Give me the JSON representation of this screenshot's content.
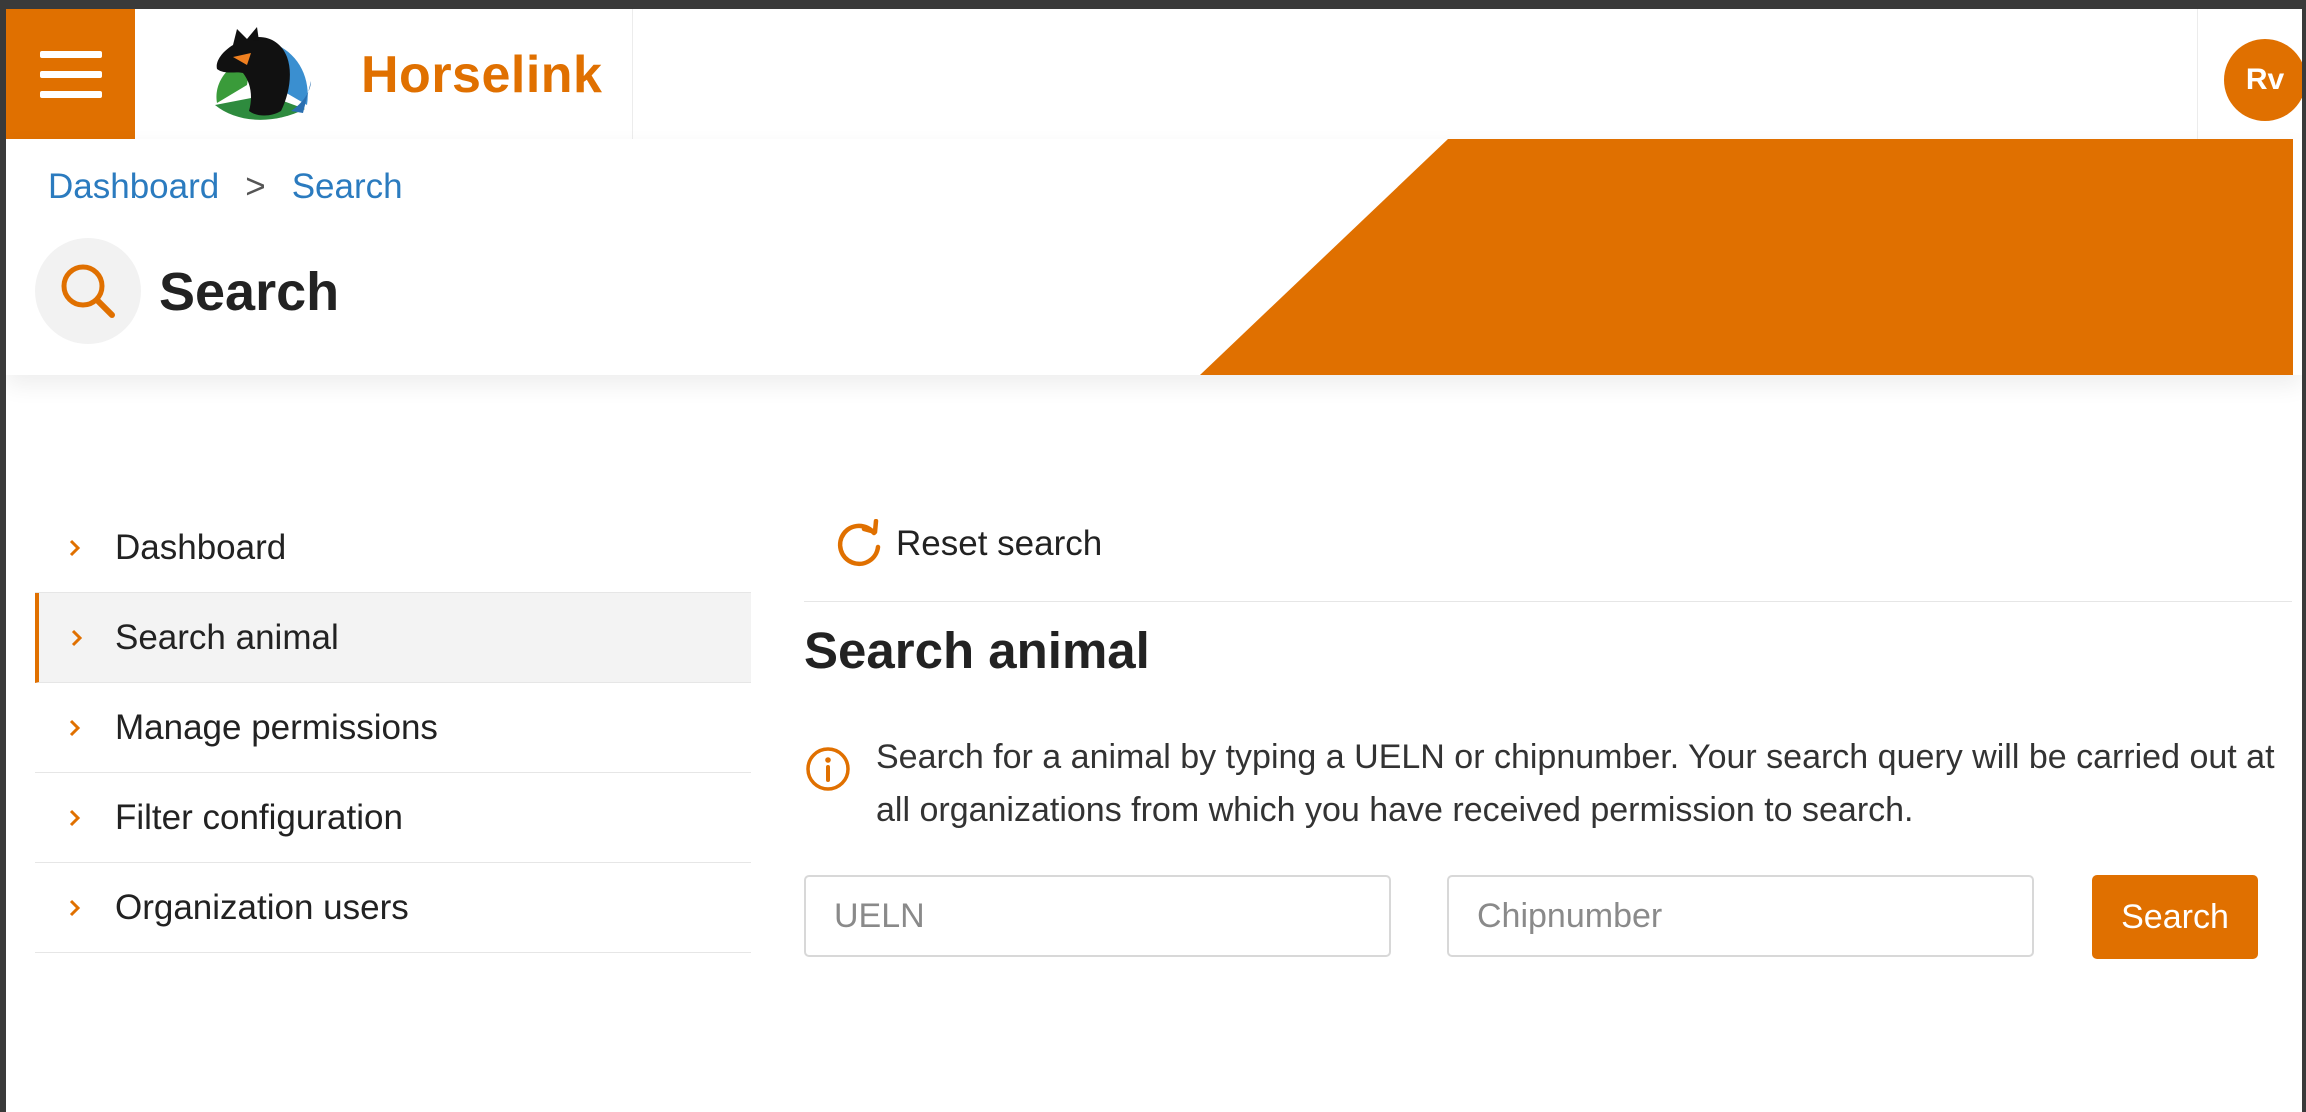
{
  "header": {
    "brand": "Horselink",
    "avatar_initials": "Rv",
    "icons": {
      "menu": "hamburger-menu-icon",
      "logo": "horse-logo-icon"
    }
  },
  "breadcrumb": {
    "items": [
      "Dashboard",
      "Search"
    ],
    "separator": ">"
  },
  "page": {
    "title": "Search",
    "title_icon": "search-icon"
  },
  "sidebar": {
    "items": [
      {
        "label": "Dashboard",
        "active": false
      },
      {
        "label": "Search animal",
        "active": true
      },
      {
        "label": "Manage permissions",
        "active": false
      },
      {
        "label": "Filter configuration",
        "active": false
      },
      {
        "label": "Organization users",
        "active": false
      }
    ],
    "item_icon": "chevron-right-icon"
  },
  "main": {
    "reset_label": "Reset search",
    "reset_icon": "refresh-icon",
    "section_title": "Search animal",
    "info_icon": "info-icon",
    "info_text": "Search for a animal by typing a UELN or chipnumber. Your search query will be carried out at all organizations from which you have received permission to search.",
    "ueln_placeholder": "UELN",
    "ueln_value": "",
    "chip_placeholder": "Chipnumber",
    "chip_value": "",
    "search_label": "Search"
  },
  "colors": {
    "accent": "#e07000",
    "link": "#2b7bbf",
    "active_bg": "#f3f3f3"
  }
}
